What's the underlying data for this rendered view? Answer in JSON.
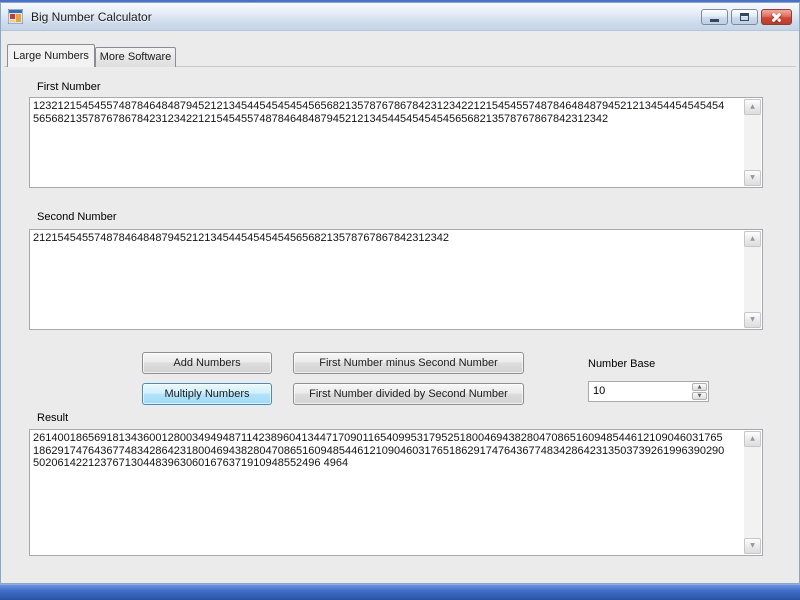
{
  "window": {
    "title": "Big Number Calculator"
  },
  "tabs": [
    {
      "label": "Large Numbers",
      "active": true
    },
    {
      "label": "More Software",
      "active": false
    }
  ],
  "fields": {
    "first_number": {
      "label": "First Number",
      "value": "123212154545574878464848794521213454454545454565682135787678678423123422121545455748784648487945212134544545454545656821357876786784231234221215454557487846484879452121345445454545456568213578767867842312342"
    },
    "second_number": {
      "label": "Second Number",
      "value": "21215454557487846484879452121345445454545456568213578767867842312342"
    },
    "result": {
      "label": "Result",
      "value": "261400186569181343600128003494948711423896041344717090116540995317952518004694382804708651609485446121090460317651862917476436774834286423180046943828047086516094854461210904603176518629174764367748342864231350373926199639029050206142212376713044839630601676371910948552496 4964"
    }
  },
  "buttons": {
    "add": "Add Numbers",
    "multiply": "Multiply Numbers",
    "subtract": "First Number minus Second Number",
    "divide": "First Number divided by Second Number"
  },
  "number_base": {
    "label": "Number Base",
    "value": "10"
  },
  "icons": {
    "scroll_up": "▲",
    "scroll_down": "▼",
    "spin_up": "▲",
    "spin_down": "▼"
  },
  "colors": {
    "highlight_button": "#b4e4fa",
    "close_button": "#cc4837",
    "taskbar": "#3f6cc6"
  }
}
